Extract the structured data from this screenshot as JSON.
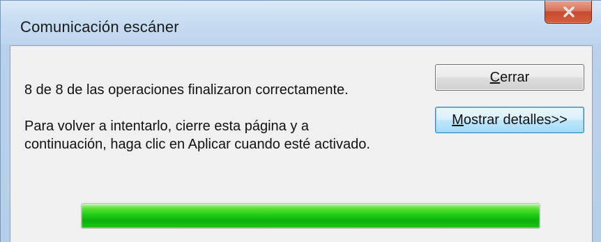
{
  "window": {
    "title": "Comunicación escáner",
    "close_glyph": "X"
  },
  "message": {
    "line1": "8 de  8 de las operaciones finalizaron correctamente.",
    "line2a": "Para volver a intentarlo, cierre esta página y a",
    "line2b": "continuación, haga clic en Aplicar cuando esté activado."
  },
  "buttons": {
    "close": {
      "underlined": "C",
      "rest": "errar"
    },
    "details": {
      "underlined": "M",
      "rest": "ostrar detalles>>"
    }
  },
  "progress": {
    "percent": 100,
    "color": "#1fcc16"
  },
  "colors": {
    "titlebar": "#c6dcf2",
    "client": "#f0f0f0",
    "close_button": "#c74a2e",
    "focused_button_border": "#3c7fb1"
  }
}
